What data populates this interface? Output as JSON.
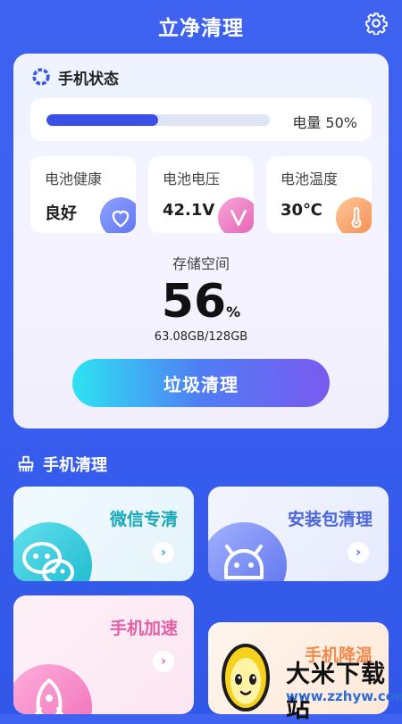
{
  "header": {
    "title": "立净清理"
  },
  "status": {
    "title": "手机状态",
    "battery_label": "电量 50%",
    "battery_level": 0.5,
    "health": {
      "label": "电池健康",
      "value": "良好"
    },
    "voltage": {
      "label": "电池电压",
      "value": "42.1V"
    },
    "temperature": {
      "label": "电池温度",
      "value": "30℃"
    },
    "storage_label": "存储空间",
    "storage_percent": "56",
    "storage_unit": "%",
    "storage_size": "63.08GB/128GB",
    "clean_button": "垃圾清理"
  },
  "section": {
    "title": "手机清理"
  },
  "tools": [
    {
      "label": "微信专清"
    },
    {
      "label": "安装包清理"
    },
    {
      "label": "手机加速"
    },
    {
      "label": "手机降温"
    }
  ],
  "watermark": {
    "brand": "大米下载站",
    "url": "www.zzhyw.com"
  },
  "colors": {
    "accent": "#3b50e6",
    "background": "#3f63f0",
    "wechat": "#1aa7b8",
    "boost": "#e25fa6",
    "apk": "#4a66d9"
  }
}
